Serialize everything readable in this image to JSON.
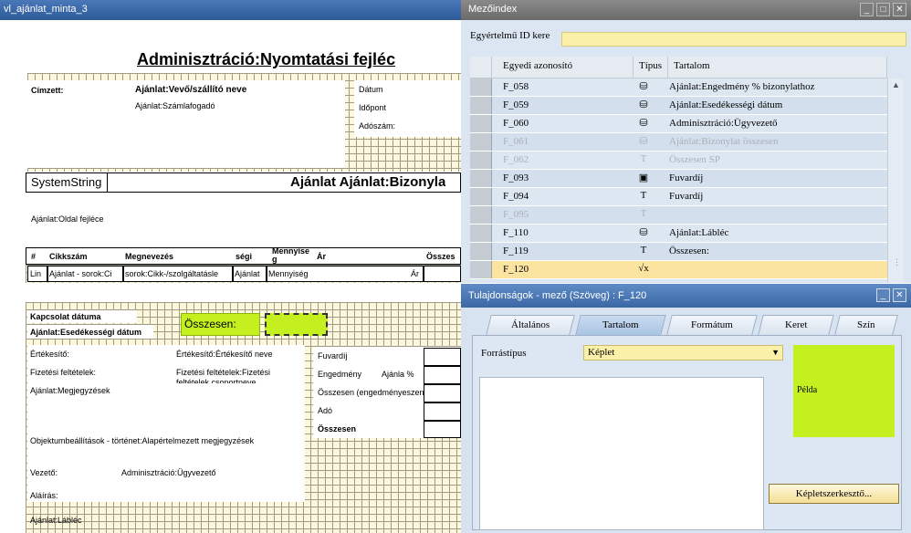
{
  "designer": {
    "window_title": "vl_ajánlat_minta_3",
    "page_title": "Adminisztráció:Nyomtatási fejléc",
    "header": {
      "recipient_label": "Címzett:",
      "vendor_name": "Ajánlat:Vevő/szállító neve",
      "bill_to": "Ajánlat:Számlafogadó",
      "date_label": "Dátum",
      "time_label": "Időpont",
      "tax_label": "Adószám:",
      "system_string": "SystemString",
      "doc_title": "Ajánlat  Ajánlat:Bizonyla",
      "page_header": "Ajánlat:Oldal fejléce"
    },
    "columns": {
      "num": "#",
      "item": "Cikkszám",
      "name": "Megnevezés",
      "unit": "ségi",
      "qty_top": "Mennyise",
      "qty_bottom": "g",
      "price": "Ár",
      "total": "Összes"
    },
    "row": {
      "line": "Lin",
      "item": "Ajánlat - sorok:Ci",
      "desc": "sorok:Cikk-/szolgáltatásle",
      "unit": "Ajánlat",
      "qty": "Mennyiség",
      "price": "Ár"
    },
    "footer": {
      "contact_date": "Kapcsolat dátuma",
      "due_date": "Ajánlat:Esedékességi dátum",
      "total_field": "Összesen:",
      "sales_label": "Értékesítő:",
      "sales_value": "Értékesítő:Értékesítő neve",
      "payment_label": "Fizetési feltételek:",
      "payment_value_1": "Fizetési feltételek:Fizetési",
      "payment_value_2": "feltételek csoportneve",
      "remarks": "Ajánlat:Megjegyzések",
      "freight": "Fuvardíj",
      "discount": "Engedmény",
      "discount_pct": "Ajánla %",
      "total_before": "Összesen (engedményeszen",
      "tax": "Adó",
      "grand_total": "Összesen",
      "object_settings": "Objektumbeállítások - történet:Alapértelmezett megjegyzések",
      "manager_label": "Vezető:",
      "manager_value": "Adminisztráció:Ügyvezető",
      "signature": "Aláírás:",
      "footer_field": "Ajánlat:Lábléc"
    }
  },
  "field_index": {
    "window_title": "Mezőindex",
    "unique_id_label": "Egyértelmű ID kere",
    "unique_id_value": "",
    "col_id": "Egyedi azonosító",
    "col_type": "Típus",
    "col_content": "Tartalom",
    "rows": [
      {
        "id": "F_058",
        "type_icon": "db-icon",
        "type_glyph": "⛁",
        "content": "Ajánlat:Engedmény % bizonylathoz",
        "disabled": false
      },
      {
        "id": "F_059",
        "type_icon": "db-icon",
        "type_glyph": "⛁",
        "content": "Ajánlat:Esedékességi dátum",
        "disabled": false
      },
      {
        "id": "F_060",
        "type_icon": "db-icon",
        "type_glyph": "⛁",
        "content": "Adminisztráció:Ügyvezető",
        "disabled": false
      },
      {
        "id": "F_061",
        "type_icon": "db-icon",
        "type_glyph": "⛁",
        "content": "Ajánlat:Bizonylat összesen",
        "disabled": true
      },
      {
        "id": "F_062",
        "type_icon": "text-icon",
        "type_glyph": "T",
        "content": "Összesen SP",
        "disabled": true
      },
      {
        "id": "F_093",
        "type_icon": "picture-icon",
        "type_glyph": "▣",
        "content": "Fuvardíj",
        "disabled": false
      },
      {
        "id": "F_094",
        "type_icon": "text-icon",
        "type_glyph": "T",
        "content": "Fuvardíj",
        "disabled": false
      },
      {
        "id": "F_095",
        "type_icon": "text-icon",
        "type_glyph": "T",
        "content": "",
        "disabled": true
      },
      {
        "id": "F_110",
        "type_icon": "db-icon",
        "type_glyph": "⛁",
        "content": "Ajánlat:Lábléc",
        "disabled": false
      },
      {
        "id": "F_119",
        "type_icon": "text-icon",
        "type_glyph": "T",
        "content": "Összesen:",
        "disabled": false
      },
      {
        "id": "F_120",
        "type_icon": "formula-icon",
        "type_glyph": "√x",
        "content": "",
        "disabled": false,
        "current": true
      }
    ]
  },
  "properties": {
    "window_title": "Tulajdonságok - mező (Szöveg) : F_120",
    "tabs": [
      "Általános",
      "Tartalom",
      "Formátum",
      "Keret",
      "Szín"
    ],
    "active_tab": "Tartalom",
    "source_type_label": "Forrástípus",
    "source_type_value": "Képlet",
    "formula_text": "",
    "sample_label": "Példa",
    "sample_color": "#c3f01e",
    "formula_editor_button": "Képletszerkesztő..."
  }
}
